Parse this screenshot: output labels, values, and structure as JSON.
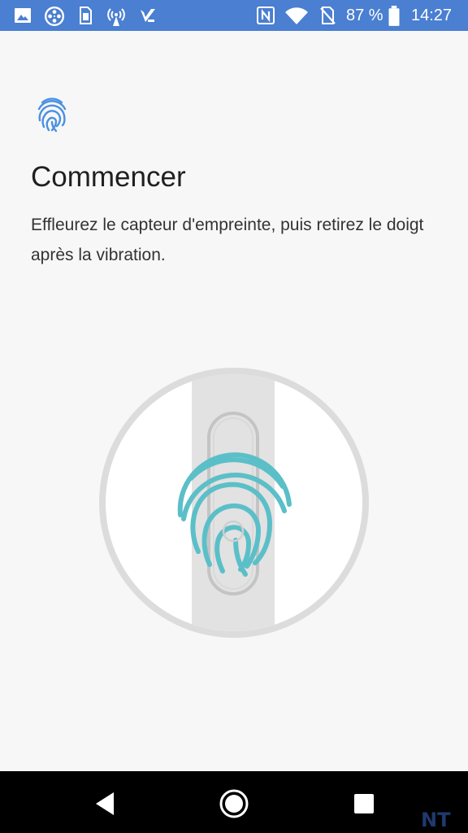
{
  "status_bar": {
    "battery_percent": "87 %",
    "time": "14:27",
    "left_icons": [
      "gallery-icon",
      "film-reel-icon",
      "sim-card-icon",
      "hotspot-icon",
      "check-app-icon"
    ],
    "right_icons": [
      "nfc-icon",
      "wifi-icon",
      "no-sim-icon",
      "battery-icon"
    ],
    "background_color": "#4a7fd1"
  },
  "screen": {
    "header_icon": "fingerprint-icon",
    "title": "Commencer",
    "description": "Effleurez le capteur d'empreinte, puis retirez le doigt après la vibration.",
    "accent_color": "#4a90e2",
    "fingerprint_color": "#5bbfc8"
  },
  "nav_bar": {
    "buttons": [
      "back-button",
      "home-button",
      "recents-button"
    ]
  },
  "watermark": {
    "text": "NT"
  }
}
